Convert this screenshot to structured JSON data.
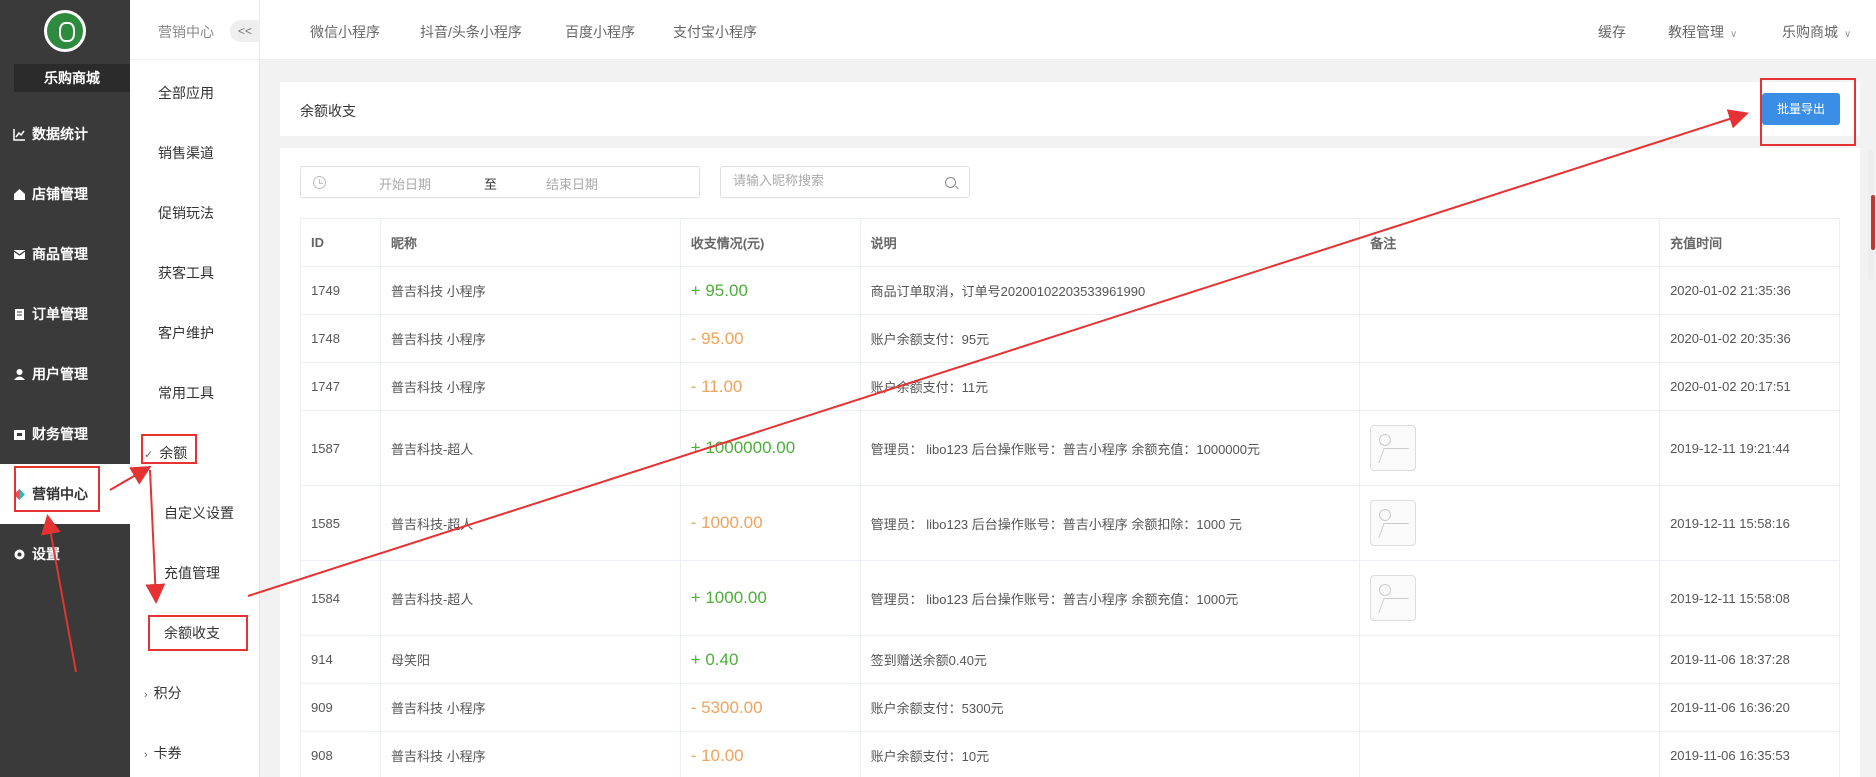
{
  "brand": {
    "shop_name": "乐购商城",
    "accent": "#3a8ee6",
    "sidebar_bg": "#3a3a3a"
  },
  "sidebar": {
    "items": [
      {
        "icon": "chart-line-icon",
        "label": "数据统计"
      },
      {
        "icon": "store-icon",
        "label": "店铺管理"
      },
      {
        "icon": "goods-icon",
        "label": "商品管理"
      },
      {
        "icon": "order-icon",
        "label": "订单管理"
      },
      {
        "icon": "user-icon",
        "label": "用户管理"
      },
      {
        "icon": "finance-icon",
        "label": "财务管理"
      },
      {
        "icon": "marketing-icon",
        "label": "营销中心",
        "active": true
      },
      {
        "icon": "gear-icon",
        "label": "设置"
      }
    ]
  },
  "subnav": {
    "title": "营销中心",
    "collapse": "<<",
    "items": [
      "全部应用",
      "销售渠道",
      "促销玩法",
      "获客工具",
      "客户维护",
      "常用工具"
    ],
    "balance_group": "余额",
    "balance_children": [
      "自定义设置",
      "充值管理",
      "余额收支"
    ],
    "points_group": "积分",
    "coupon_group": "卡券"
  },
  "topbar": {
    "tabs": [
      "微信小程序",
      "抖音/头条小程序",
      "百度小程序",
      "支付宝小程序"
    ],
    "cache": "缓存",
    "tutorial": "教程管理",
    "account": "乐购商城"
  },
  "panel": {
    "title": "余额收支",
    "export_label": "批量导出"
  },
  "filters": {
    "start_placeholder": "开始日期",
    "separator": "至",
    "end_placeholder": "结束日期",
    "search_placeholder": "请输入昵称搜索"
  },
  "table": {
    "columns": [
      "ID",
      "昵称",
      "收支情况(元)",
      "说明",
      "备注",
      "充值时间"
    ],
    "rows": [
      {
        "id": "1749",
        "name": "普吉科技 小程序",
        "amount": "+ 95.00",
        "type": "plus",
        "desc": "商品订单取消，订单号202001022035339619​90",
        "image": false,
        "time": "2020-01-02 21:35:36"
      },
      {
        "id": "1748",
        "name": "普吉科技 小程序",
        "amount": "- 95.00",
        "type": "minus",
        "desc": "账户余额支付：95元",
        "image": false,
        "time": "2020-01-02 20:35:36"
      },
      {
        "id": "1747",
        "name": "普吉科技 小程序",
        "amount": "- 11.00",
        "type": "minus",
        "desc": "账户余额支付：11元",
        "image": false,
        "time": "2020-01-02 20:17:51"
      },
      {
        "id": "1587",
        "name": "普吉科技-超人",
        "amount": "+ 1000000.00",
        "type": "plus",
        "desc": "管理员： libo123 后台操作账号：普吉小程序 余额充值：1000000元",
        "image": true,
        "time": "2019-12-11 19:21:44"
      },
      {
        "id": "1585",
        "name": "普吉科技-超人",
        "amount": "- 1000.00",
        "type": "minus",
        "desc": "管理员： libo123 后台操作账号：普吉小程序 余额扣除：1000 元",
        "image": true,
        "time": "2019-12-11 15:58:16"
      },
      {
        "id": "1584",
        "name": "普吉科技-超人",
        "amount": "+ 1000.00",
        "type": "plus",
        "desc": "管理员： libo123 后台操作账号：普吉小程序 余额充值：1000元",
        "image": true,
        "time": "2019-12-11 15:58:08"
      },
      {
        "id": "914",
        "name": "母笑阳",
        "amount": "+ 0.40",
        "type": "plus",
        "desc": "签到赠送余额0.40元",
        "image": false,
        "time": "2019-11-06 18:37:28"
      },
      {
        "id": "909",
        "name": "普吉科技 小程序",
        "amount": "- 5300.00",
        "type": "minus",
        "desc": "账户余额支付：5300元",
        "image": false,
        "time": "2019-11-06 16:36:20"
      },
      {
        "id": "908",
        "name": "普吉科技 小程序",
        "amount": "- 10.00",
        "type": "minus",
        "desc": "账户余额支付：10元",
        "image": false,
        "time": "2019-11-06 16:35:53"
      }
    ]
  }
}
